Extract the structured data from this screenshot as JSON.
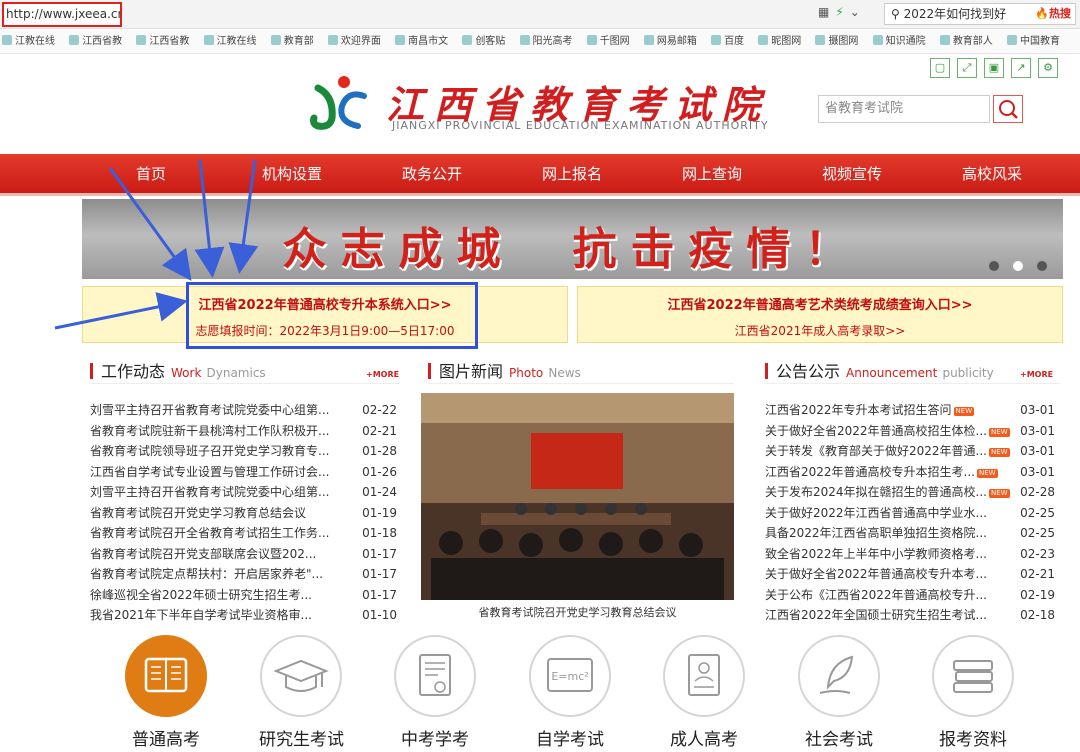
{
  "browser": {
    "url": "http://www.jxeea.cn/",
    "toolbar_icons": [
      "grid-icon",
      "lightning-icon",
      "chevron-down-icon"
    ],
    "search_value": "2022年如何找到好",
    "search_hot_label": "热搜"
  },
  "bookmarks": [
    "江教在线",
    "江西省教",
    "江西省教",
    "江教在线",
    "教育部",
    "欢迎界面",
    "南昌市文",
    "创客贴",
    "阳光高考",
    "千图网",
    "网易邮箱",
    "百度",
    "昵图网",
    "摄图网",
    "知识通院",
    "教育部人",
    "中国教育"
  ],
  "header": {
    "logo_cn": "江西省教育考试院",
    "logo_en": "JIANGXI PROVINCIAL EDUCATION EXAMINATION AUTHORITY",
    "search_placeholder": "省教育考试院",
    "tool_icons": [
      "copy-icon",
      "fullscreen-icon",
      "save-icon",
      "share-icon",
      "settings-icon"
    ]
  },
  "nav": [
    "首页",
    "机构设置",
    "政务公开",
    "网上报名",
    "网上查询",
    "视频宣传",
    "高校风采"
  ],
  "banner": {
    "slogan": "众志成城　抗击疫情！",
    "dots": 3,
    "active_dot": 1
  },
  "notice_left": {
    "title": "江西省2022年普通高校专升本系统入口>>",
    "subtitle": "志愿填报时间：2022年3月1日9:00—5日17:00"
  },
  "notice_right": {
    "title": "江西省2022年普通高考艺术类统考成绩查询入口>>",
    "subtitle": "江西省2021年成人高考录取>>"
  },
  "work": {
    "title_cn": "工作动态",
    "title_en1": "Work",
    "title_en2": "Dynamics",
    "more": "+MORE",
    "items": [
      {
        "t": "刘雪平主持召开省教育考试院党委中心组第...",
        "d": "02-22"
      },
      {
        "t": "省教育考试院驻新干县桃湾村工作队积极开...",
        "d": "02-21"
      },
      {
        "t": "省教育考试院领导班子召开党史学习教育专...",
        "d": "01-28"
      },
      {
        "t": "江西省自学考试专业设置与管理工作研讨会...",
        "d": "01-26"
      },
      {
        "t": "刘雪平主持召开省教育考试院党委中心组第...",
        "d": "01-24"
      },
      {
        "t": "省教育考试院召开党史学习教育总结会议",
        "d": "01-19"
      },
      {
        "t": "省教育考试院召开全省教育考试招生工作务...",
        "d": "01-18"
      },
      {
        "t": "省教育考试院召开党支部联席会议暨202...",
        "d": "01-17"
      },
      {
        "t": "省教育考试院定点帮扶村：开启居家养老\"...",
        "d": "01-17"
      },
      {
        "t": "徐峰巡视全省2022年硕士研究生招生考...",
        "d": "01-17"
      },
      {
        "t": "我省2021年下半年自学考试毕业资格审...",
        "d": "01-10"
      }
    ]
  },
  "photo": {
    "title_cn": "图片新闻",
    "title_en1": "Photo",
    "title_en2": "News",
    "caption": "省教育考试院召开党史学习教育总结会议"
  },
  "notice": {
    "title_cn": "公告公示",
    "title_en1": "Announcement",
    "title_en2": "publicity",
    "more": "+MORE",
    "new_label": "NEW",
    "items": [
      {
        "t": "江西省2022年专升本考试招生答问",
        "d": "03-01",
        "new": true
      },
      {
        "t": "关于做好全省2022年普通高校招生体检...",
        "d": "03-01",
        "new": true
      },
      {
        "t": "关于转发《教育部关于做好2022年普通...",
        "d": "03-01",
        "new": true
      },
      {
        "t": "江西省2022年普通高校专升本招生考...",
        "d": "03-01",
        "new": true
      },
      {
        "t": "关于发布2024年拟在赣招生的普通高校...",
        "d": "02-28",
        "new": true
      },
      {
        "t": "关于做好2022年江西省普通高中学业水...",
        "d": "02-25",
        "new": false
      },
      {
        "t": "具备2022年江西省高职单独招生资格院...",
        "d": "02-25",
        "new": false
      },
      {
        "t": "致全省2022年上半年中小学教师资格考...",
        "d": "02-23",
        "new": false
      },
      {
        "t": "关于做好全省2022年普通高校专升本考...",
        "d": "02-21",
        "new": false
      },
      {
        "t": "关于公布《江西省2022年普通高校专升...",
        "d": "02-19",
        "new": false
      },
      {
        "t": "江西省2022年全国硕士研究生招生考试...",
        "d": "02-18",
        "new": false
      }
    ]
  },
  "categories": [
    {
      "label": "普通高考",
      "icon": "book-icon",
      "active": true
    },
    {
      "label": "研究生考试",
      "icon": "graduation-cap-icon",
      "active": false
    },
    {
      "label": "中考学考",
      "icon": "certificate-icon",
      "active": false
    },
    {
      "label": "自学考试",
      "icon": "formula-board-icon",
      "active": false
    },
    {
      "label": "成人高考",
      "icon": "person-card-icon",
      "active": false
    },
    {
      "label": "社会考试",
      "icon": "quill-pen-icon",
      "active": false
    },
    {
      "label": "报考资料",
      "icon": "book-stack-icon",
      "active": false
    }
  ],
  "colors": {
    "brand_red": "#d21e1e",
    "nav_red": "#e43a2c",
    "highlight_blue": "#2f50d8",
    "notice_bg": "#fff7c7",
    "category_active": "#e07c14"
  }
}
